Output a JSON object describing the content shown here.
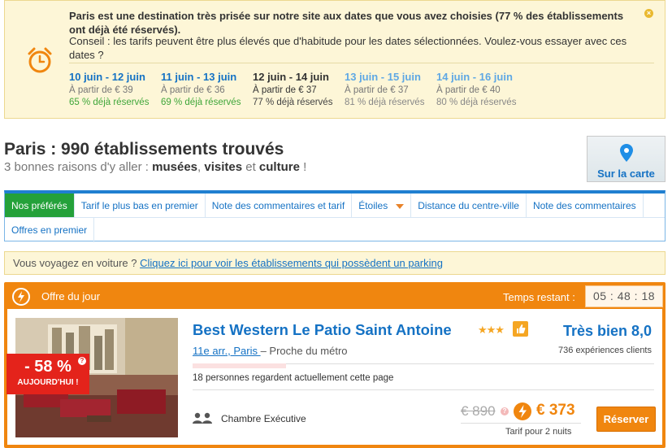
{
  "alert": {
    "title": "Paris est une destination très prisée sur notre site aux dates que vous avez choisies (77 % des établissements ont déjà été réservés).",
    "tip": "Conseil : les tarifs peuvent être plus élevés que d'habitude pour les dates sélectionnées. Voulez-vous essayer avec ces dates ?",
    "dates": [
      {
        "range": "10 juin - 12 juin",
        "price": "À partir de € 39",
        "booked": "65 % déjà réservés",
        "state": "available"
      },
      {
        "range": "11 juin - 13 juin",
        "price": "À partir de € 36",
        "booked": "69 % déjà réservés",
        "state": "available"
      },
      {
        "range": "12 juin - 14 juin",
        "price": "À partir de € 37",
        "booked": "77 % déjà réservés",
        "state": "selected"
      },
      {
        "range": "13 juin - 15 juin",
        "price": "À partir de € 37",
        "booked": "81 % déjà réservés",
        "state": "other"
      },
      {
        "range": "14 juin - 16 juin",
        "price": "À partir de € 40",
        "booked": "80 % déjà réservés",
        "state": "other"
      }
    ],
    "close_icon": "close-icon",
    "clock_icon": "alarm-clock-icon"
  },
  "results": {
    "title": "Paris : 990 établissements trouvés",
    "reasons_prefix": "3 bonnes raisons d'y aller : ",
    "reason_1": "musées",
    "sep_1": ", ",
    "reason_2": "visites",
    "sep_2": " et ",
    "reason_3": "culture",
    "suffix": " !",
    "map_label": "Sur la carte"
  },
  "sort": {
    "row1": [
      "Nos préférés",
      "Tarif le plus bas en premier",
      "Note des commentaires et tarif",
      "Étoiles",
      "Distance du centre-ville",
      "Note des commentaires"
    ],
    "row2": [
      "Offres en premier"
    ],
    "active_index": 0
  },
  "parking": {
    "prefix": "Vous voyagez en voiture ? ",
    "link": "Cliquez ici pour voir les établissements qui possèdent un parking"
  },
  "deal": {
    "title": "Offre du jour",
    "remaining_label": "Temps restant :",
    "timer": "05 : 48 : 18",
    "discount_pct": "- 58 %",
    "discount_label": "AUJOURD'HUI !",
    "hotel_name": "Best Western Le Patio Saint Antoine",
    "stars": 3,
    "stars_text": "★★★",
    "location_link": "11e arr., Paris ",
    "location_rest": "– Proche du métro",
    "rating_word": "Très bien 8,0",
    "reviews": "736 expériences clients",
    "viewers": "18 personnes regardent actuellement cette page",
    "room": "Chambre Exécutive",
    "old_price": "€ 890",
    "new_price": "€ 373",
    "price_note": "Tarif pour 2 nuits",
    "book_label": "Réserver",
    "colors": {
      "accent": "#f0860f",
      "link": "#1572c4",
      "discount": "#e4231b",
      "active_tab": "#24a13a"
    }
  }
}
